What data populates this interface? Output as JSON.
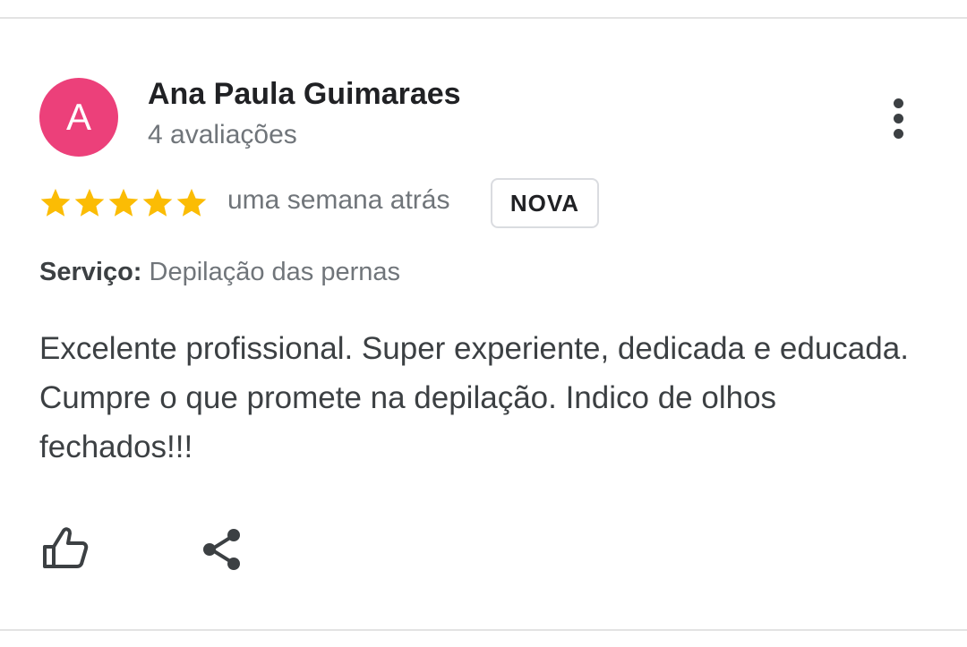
{
  "review": {
    "avatar_letter": "A",
    "avatar_color": "#ec407a",
    "author_name": "Ana Paula Guimaraes",
    "author_review_count": "4 avaliações",
    "more_icon": "more-vert-icon",
    "rating": 5,
    "rating_max": 5,
    "star_color": "#fbbc04",
    "time_ago": "uma semana atrás",
    "badge": "NOVA",
    "service_label": "Serviço:",
    "service_value": "Depilação das pernas",
    "text": "Excelente profissional. Super experiente, dedicada e educada. Cumpre o que promete na depilação. Indico de olhos fechados!!!",
    "actions": {
      "like_icon": "thumb-up-icon",
      "share_icon": "share-icon"
    }
  }
}
